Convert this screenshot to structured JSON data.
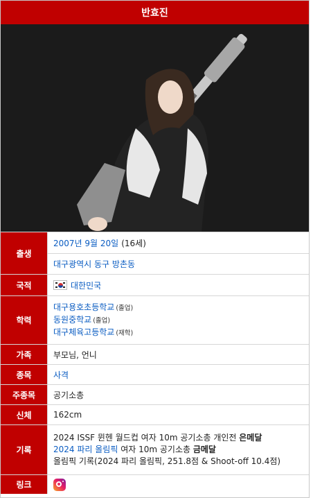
{
  "name": "반효진",
  "photo": {
    "subject": "athlete-portrait-with-air-rifle"
  },
  "birth": {
    "label": "출생",
    "date": "2007년 9월 20일",
    "age": "(16세)",
    "place": "대구광역시 동구 방촌동"
  },
  "nationality": {
    "label": "국적",
    "flag_icon": "south-korea-flag-icon",
    "country": "대한민국"
  },
  "education": {
    "label": "학력",
    "schools": [
      {
        "name": "대구용호초등학교",
        "status": "(졸업)"
      },
      {
        "name": "동원중학교",
        "status": "(졸업)"
      },
      {
        "name": "대구체육고등학교",
        "status": "(재학)"
      }
    ]
  },
  "family": {
    "label": "가족",
    "value": "부모님, 언니"
  },
  "sport": {
    "label": "종목",
    "value": "사격"
  },
  "main_event": {
    "label": "주종목",
    "value": "공기소총"
  },
  "body": {
    "label": "신체",
    "value": "162cm"
  },
  "records": {
    "label": "기록",
    "items": [
      {
        "prefix": "2024 ISSF 뮌헨 월드컵 여자 10m 공기소총 개인전 ",
        "medal": "은메달"
      },
      {
        "link": "2024 파리 올림픽",
        "middle": " 여자 10m 공기소총 ",
        "medal": "금메달"
      },
      {
        "text": "올림픽 기록(2024 파리 올림픽, 251.8점 & Shoot-off 10.4점)"
      }
    ]
  },
  "links": {
    "label": "링크",
    "icon": "instagram-icon"
  },
  "colors": {
    "header": "#c00000",
    "link": "#0a5cc2",
    "photo_bg": "#1b1b1b"
  }
}
